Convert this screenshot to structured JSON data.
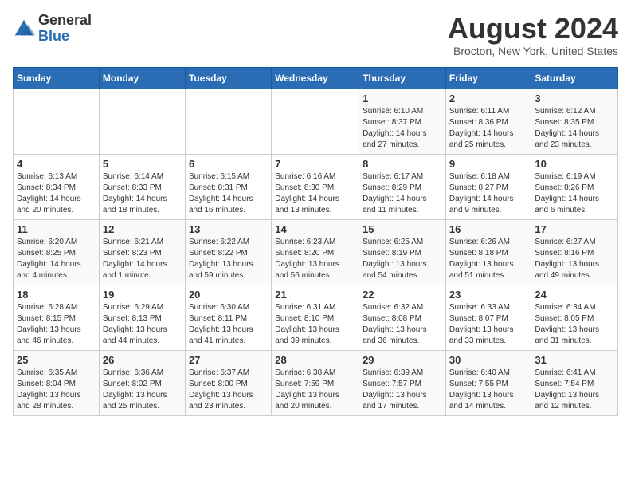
{
  "header": {
    "logo_general": "General",
    "logo_blue": "Blue",
    "month_year": "August 2024",
    "location": "Brocton, New York, United States"
  },
  "weekdays": [
    "Sunday",
    "Monday",
    "Tuesday",
    "Wednesday",
    "Thursday",
    "Friday",
    "Saturday"
  ],
  "weeks": [
    [
      {
        "day": "",
        "info": ""
      },
      {
        "day": "",
        "info": ""
      },
      {
        "day": "",
        "info": ""
      },
      {
        "day": "",
        "info": ""
      },
      {
        "day": "1",
        "info": "Sunrise: 6:10 AM\nSunset: 8:37 PM\nDaylight: 14 hours\nand 27 minutes."
      },
      {
        "day": "2",
        "info": "Sunrise: 6:11 AM\nSunset: 8:36 PM\nDaylight: 14 hours\nand 25 minutes."
      },
      {
        "day": "3",
        "info": "Sunrise: 6:12 AM\nSunset: 8:35 PM\nDaylight: 14 hours\nand 23 minutes."
      }
    ],
    [
      {
        "day": "4",
        "info": "Sunrise: 6:13 AM\nSunset: 8:34 PM\nDaylight: 14 hours\nand 20 minutes."
      },
      {
        "day": "5",
        "info": "Sunrise: 6:14 AM\nSunset: 8:33 PM\nDaylight: 14 hours\nand 18 minutes."
      },
      {
        "day": "6",
        "info": "Sunrise: 6:15 AM\nSunset: 8:31 PM\nDaylight: 14 hours\nand 16 minutes."
      },
      {
        "day": "7",
        "info": "Sunrise: 6:16 AM\nSunset: 8:30 PM\nDaylight: 14 hours\nand 13 minutes."
      },
      {
        "day": "8",
        "info": "Sunrise: 6:17 AM\nSunset: 8:29 PM\nDaylight: 14 hours\nand 11 minutes."
      },
      {
        "day": "9",
        "info": "Sunrise: 6:18 AM\nSunset: 8:27 PM\nDaylight: 14 hours\nand 9 minutes."
      },
      {
        "day": "10",
        "info": "Sunrise: 6:19 AM\nSunset: 8:26 PM\nDaylight: 14 hours\nand 6 minutes."
      }
    ],
    [
      {
        "day": "11",
        "info": "Sunrise: 6:20 AM\nSunset: 8:25 PM\nDaylight: 14 hours\nand 4 minutes."
      },
      {
        "day": "12",
        "info": "Sunrise: 6:21 AM\nSunset: 8:23 PM\nDaylight: 14 hours\nand 1 minute."
      },
      {
        "day": "13",
        "info": "Sunrise: 6:22 AM\nSunset: 8:22 PM\nDaylight: 13 hours\nand 59 minutes."
      },
      {
        "day": "14",
        "info": "Sunrise: 6:23 AM\nSunset: 8:20 PM\nDaylight: 13 hours\nand 56 minutes."
      },
      {
        "day": "15",
        "info": "Sunrise: 6:25 AM\nSunset: 8:19 PM\nDaylight: 13 hours\nand 54 minutes."
      },
      {
        "day": "16",
        "info": "Sunrise: 6:26 AM\nSunset: 8:18 PM\nDaylight: 13 hours\nand 51 minutes."
      },
      {
        "day": "17",
        "info": "Sunrise: 6:27 AM\nSunset: 8:16 PM\nDaylight: 13 hours\nand 49 minutes."
      }
    ],
    [
      {
        "day": "18",
        "info": "Sunrise: 6:28 AM\nSunset: 8:15 PM\nDaylight: 13 hours\nand 46 minutes."
      },
      {
        "day": "19",
        "info": "Sunrise: 6:29 AM\nSunset: 8:13 PM\nDaylight: 13 hours\nand 44 minutes."
      },
      {
        "day": "20",
        "info": "Sunrise: 6:30 AM\nSunset: 8:11 PM\nDaylight: 13 hours\nand 41 minutes."
      },
      {
        "day": "21",
        "info": "Sunrise: 6:31 AM\nSunset: 8:10 PM\nDaylight: 13 hours\nand 39 minutes."
      },
      {
        "day": "22",
        "info": "Sunrise: 6:32 AM\nSunset: 8:08 PM\nDaylight: 13 hours\nand 36 minutes."
      },
      {
        "day": "23",
        "info": "Sunrise: 6:33 AM\nSunset: 8:07 PM\nDaylight: 13 hours\nand 33 minutes."
      },
      {
        "day": "24",
        "info": "Sunrise: 6:34 AM\nSunset: 8:05 PM\nDaylight: 13 hours\nand 31 minutes."
      }
    ],
    [
      {
        "day": "25",
        "info": "Sunrise: 6:35 AM\nSunset: 8:04 PM\nDaylight: 13 hours\nand 28 minutes."
      },
      {
        "day": "26",
        "info": "Sunrise: 6:36 AM\nSunset: 8:02 PM\nDaylight: 13 hours\nand 25 minutes."
      },
      {
        "day": "27",
        "info": "Sunrise: 6:37 AM\nSunset: 8:00 PM\nDaylight: 13 hours\nand 23 minutes."
      },
      {
        "day": "28",
        "info": "Sunrise: 6:38 AM\nSunset: 7:59 PM\nDaylight: 13 hours\nand 20 minutes."
      },
      {
        "day": "29",
        "info": "Sunrise: 6:39 AM\nSunset: 7:57 PM\nDaylight: 13 hours\nand 17 minutes."
      },
      {
        "day": "30",
        "info": "Sunrise: 6:40 AM\nSunset: 7:55 PM\nDaylight: 13 hours\nand 14 minutes."
      },
      {
        "day": "31",
        "info": "Sunrise: 6:41 AM\nSunset: 7:54 PM\nDaylight: 13 hours\nand 12 minutes."
      }
    ]
  ]
}
